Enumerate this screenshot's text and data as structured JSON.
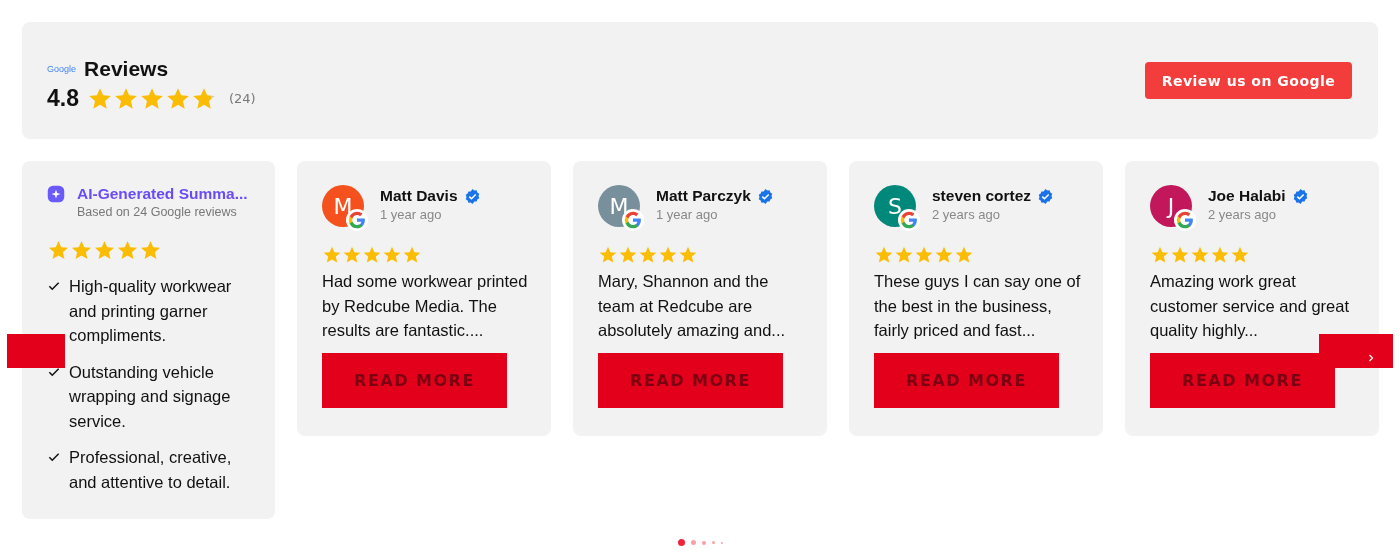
{
  "header": {
    "logo_text": "Google",
    "title": "Reviews",
    "rating": "4.8",
    "stars": 4.8,
    "count": "(24)",
    "button": "Review us on Google"
  },
  "summary": {
    "title": "AI-Generated Summa...",
    "subtitle": "Based on 24 Google reviews",
    "stars": 5,
    "points": [
      "High-quality workwear and printing garner compliments.",
      "Outstanding vehicle wrapping and signage service.",
      "Professional, creative, and attentive to detail."
    ]
  },
  "reviews": [
    {
      "initial": "M",
      "color": "#f4511e",
      "name": "Matt Davis",
      "verified": true,
      "time": "1 year ago",
      "stars": 5,
      "text": "Had some workwear printed by Redcube Media. The results are fantastic....",
      "button": "READ MORE"
    },
    {
      "initial": "M",
      "color": "#78909c",
      "name": "Matt Parczyk",
      "verified": true,
      "time": "1 year ago",
      "stars": 5,
      "text": "Mary, Shannon and the team at Redcube are absolutely amazing and...",
      "button": "READ MORE"
    },
    {
      "initial": "S",
      "color": "#00897b",
      "name": "steven cortez",
      "verified": true,
      "time": "2 years ago",
      "stars": 5,
      "text": "These guys I can say one of the best in the business, fairly priced and fast...",
      "button": "READ MORE"
    },
    {
      "initial": "J",
      "color": "#c2185b",
      "name": "Joe Halabi",
      "verified": true,
      "time": "2 years ago",
      "stars": 5,
      "text": "Amazing work great customer service and great quality highly...",
      "button": "READ MORE"
    }
  ],
  "dots": [
    {
      "selected": true
    },
    {
      "selected": false
    },
    {
      "selected": false
    },
    {
      "selected": false
    },
    {
      "selected": false
    }
  ]
}
